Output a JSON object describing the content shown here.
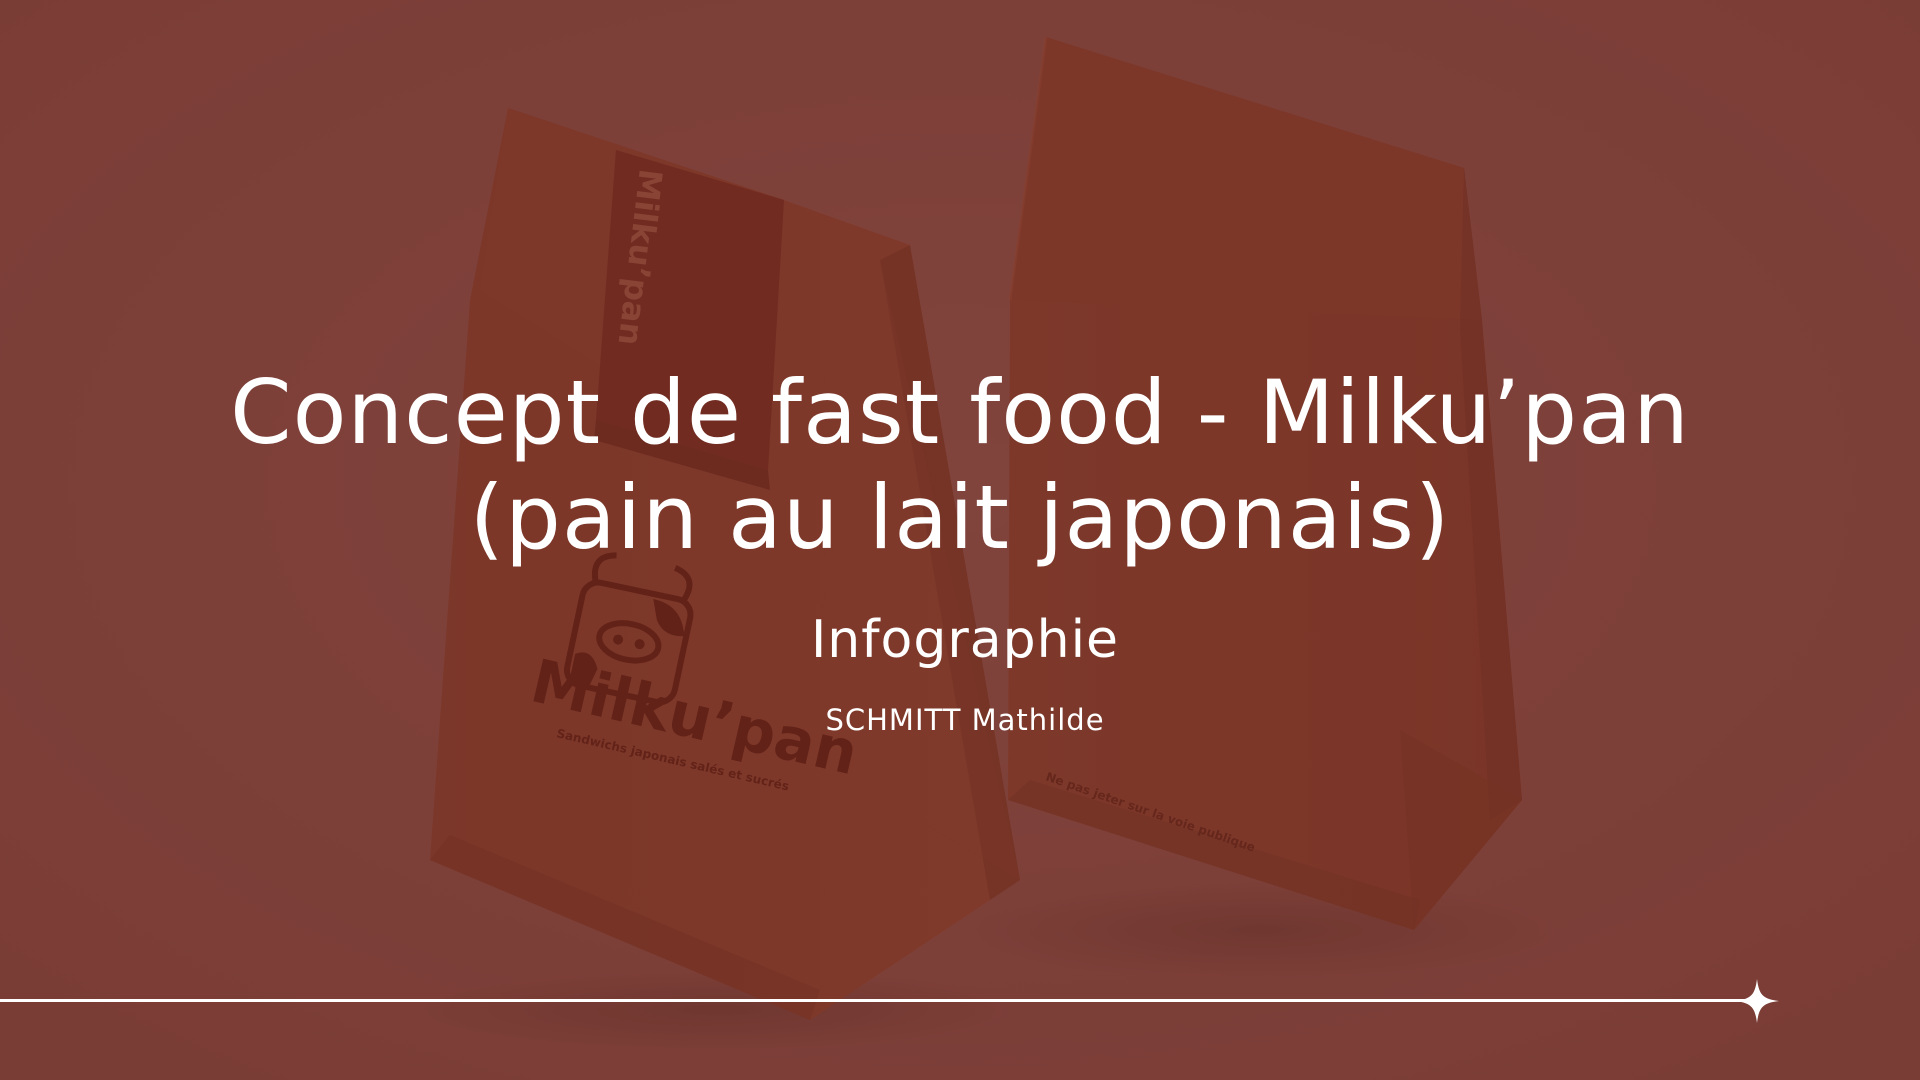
{
  "slide": {
    "title_line1": "Concept de fast food - Milku’pan",
    "title_line2": "(pain au lait japonais)",
    "subtitle": "Infographie",
    "author": "SCHMITT Mathilde"
  },
  "photo": {
    "bag_brand_vertical": "Milku’pan",
    "bag_logo_text": "Milku’pan",
    "bag_tagline": "Sandwichs japonais salés et sucrés",
    "bag_notice": "Ne pas jeter sur la voie publique"
  },
  "colors": {
    "background": "#7e4540",
    "bag": "#7a3526",
    "bag_band": "#6e281c",
    "bag_print": "#5a1c12",
    "text": "#ffffff"
  },
  "icons": {
    "divider_end": "sparkle-icon",
    "bag_logo": "cow-mascot-icon"
  }
}
